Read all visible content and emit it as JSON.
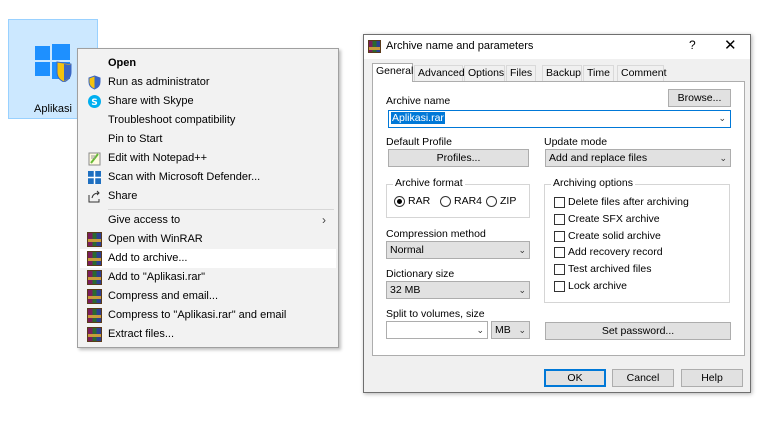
{
  "desktop": {
    "icon_label": "Aplikasi"
  },
  "context_menu": {
    "items": [
      {
        "label": "Open",
        "icon": "none"
      },
      {
        "label": "Run as administrator",
        "icon": "shield-icon"
      },
      {
        "label": "Share with Skype",
        "icon": "skype-icon"
      },
      {
        "label": "Troubleshoot compatibility",
        "icon": "none"
      },
      {
        "label": "Pin to Start",
        "icon": "none"
      },
      {
        "label": "Edit with Notepad++",
        "icon": "notepad-plus-plus-icon"
      },
      {
        "label": "Scan with Microsoft Defender...",
        "icon": "defender-icon"
      },
      {
        "label": "Share",
        "icon": "share-icon"
      },
      {
        "label": "Give access to",
        "icon": "none"
      },
      {
        "label": "Open with WinRAR",
        "icon": "winrar-icon"
      },
      {
        "label": "Add to archive...",
        "icon": "winrar-icon"
      },
      {
        "label": "Add to \"Aplikasi.rar\"",
        "icon": "winrar-icon"
      },
      {
        "label": "Compress and email...",
        "icon": "winrar-icon"
      },
      {
        "label": "Compress to \"Aplikasi.rar\" and email",
        "icon": "winrar-icon"
      },
      {
        "label": "Extract files...",
        "icon": "winrar-icon"
      }
    ],
    "submenu_arrow": "›"
  },
  "dialog": {
    "title": "Archive name and parameters",
    "help": "?",
    "close": "✕",
    "tabs": [
      "General",
      "Advanced",
      "Options",
      "Files",
      "Backup",
      "Time",
      "Comment"
    ],
    "archive_name_label": "Archive name",
    "browse": "Browse...",
    "archive_name_value": "Aplikasi.rar",
    "default_profile_label": "Default Profile",
    "profiles_button": "Profiles...",
    "update_mode_label": "Update mode",
    "update_mode_value": "Add and replace files",
    "archive_format_label": "Archive format",
    "formats": [
      "RAR",
      "RAR4",
      "ZIP"
    ],
    "selected_format": "RAR",
    "compression_label": "Compression method",
    "compression_value": "Normal",
    "dictionary_label": "Dictionary size",
    "dictionary_value": "32 MB",
    "split_label": "Split to volumes, size",
    "split_value": "",
    "split_unit": "MB",
    "archiving_options_label": "Archiving options",
    "options": [
      {
        "label": "Delete files after archiving",
        "checked": false
      },
      {
        "label": "Create SFX archive",
        "checked": false
      },
      {
        "label": "Create solid archive",
        "checked": false
      },
      {
        "label": "Add recovery record",
        "checked": false
      },
      {
        "label": "Test archived files",
        "checked": false
      },
      {
        "label": "Lock archive",
        "checked": false
      }
    ],
    "set_password": "Set password...",
    "ok": "OK",
    "cancel": "Cancel",
    "help_button": "Help"
  }
}
